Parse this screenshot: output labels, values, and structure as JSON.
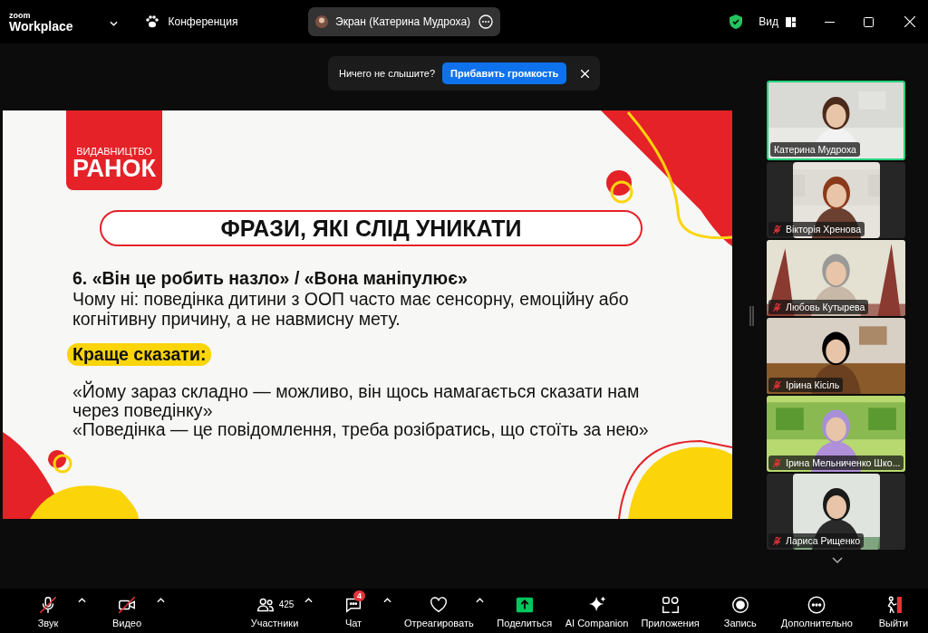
{
  "top_bar": {
    "brand_top": "zoom",
    "brand_bottom": "Workplace",
    "meeting": "Конференция",
    "share_label": "Экран (Катерина Мудроха)",
    "view": "Вид"
  },
  "notice": {
    "text": "Ничего не слышите?",
    "button": "Прибавить громкость"
  },
  "slide": {
    "logo_top": "ВИДАВНИЦТВО",
    "logo_main": "РАНОК",
    "title": "ФРАЗИ, ЯКІ СЛІД УНИКАТИ",
    "heading": "6. «Він це робить назло» / «Вона маніпулює»",
    "body": "Чому ні: поведінка дитини з ООП часто має сенсорну, емоційну або когнітивну причину, а не навмисну мету.",
    "highlight": "Краще сказати:",
    "quotes": [
      "«Йому зараз складно — можливо, він щось намагається сказати нам через поведінку»",
      "«Поведінка — це повідомлення, треба розібратись, що стоїть за нею»"
    ]
  },
  "participants": [
    {
      "name": "Катерина Мудроха",
      "muted": false,
      "speaking": true,
      "kind": "full"
    },
    {
      "name": "Вікторія Хренова",
      "muted": true,
      "speaking": false,
      "kind": "narrow"
    },
    {
      "name": "Любовь Кутырева",
      "muted": true,
      "speaking": false,
      "kind": "full"
    },
    {
      "name": "Іріина Кісіль",
      "muted": true,
      "speaking": false,
      "kind": "full"
    },
    {
      "name": "Ірина Мельниченко Шко...",
      "muted": true,
      "speaking": false,
      "kind": "full"
    },
    {
      "name": "Лариса Рищенко",
      "muted": true,
      "speaking": false,
      "kind": "narrow"
    }
  ],
  "toolbar": [
    {
      "kind": "mic",
      "label": "Звук",
      "off": true,
      "menu": true
    },
    {
      "kind": "video",
      "label": "Видео",
      "off": true,
      "menu": true
    },
    {
      "kind": "people",
      "label": "Участники",
      "count": "425",
      "menu": true
    },
    {
      "kind": "chat",
      "label": "Чат",
      "badge": "4",
      "menu": true
    },
    {
      "kind": "react",
      "label": "Отреагировать",
      "menu": true
    },
    {
      "kind": "share",
      "label": "Поделиться",
      "menu": false
    },
    {
      "kind": "ai",
      "label": "AI Companion",
      "menu": false
    },
    {
      "kind": "apps",
      "label": "Приложения",
      "menu": false
    },
    {
      "kind": "record",
      "label": "Запись",
      "menu": false
    },
    {
      "kind": "more",
      "label": "Дополнительно",
      "menu": false
    },
    {
      "kind": "leave",
      "label": "Выйти",
      "menu": false
    }
  ]
}
